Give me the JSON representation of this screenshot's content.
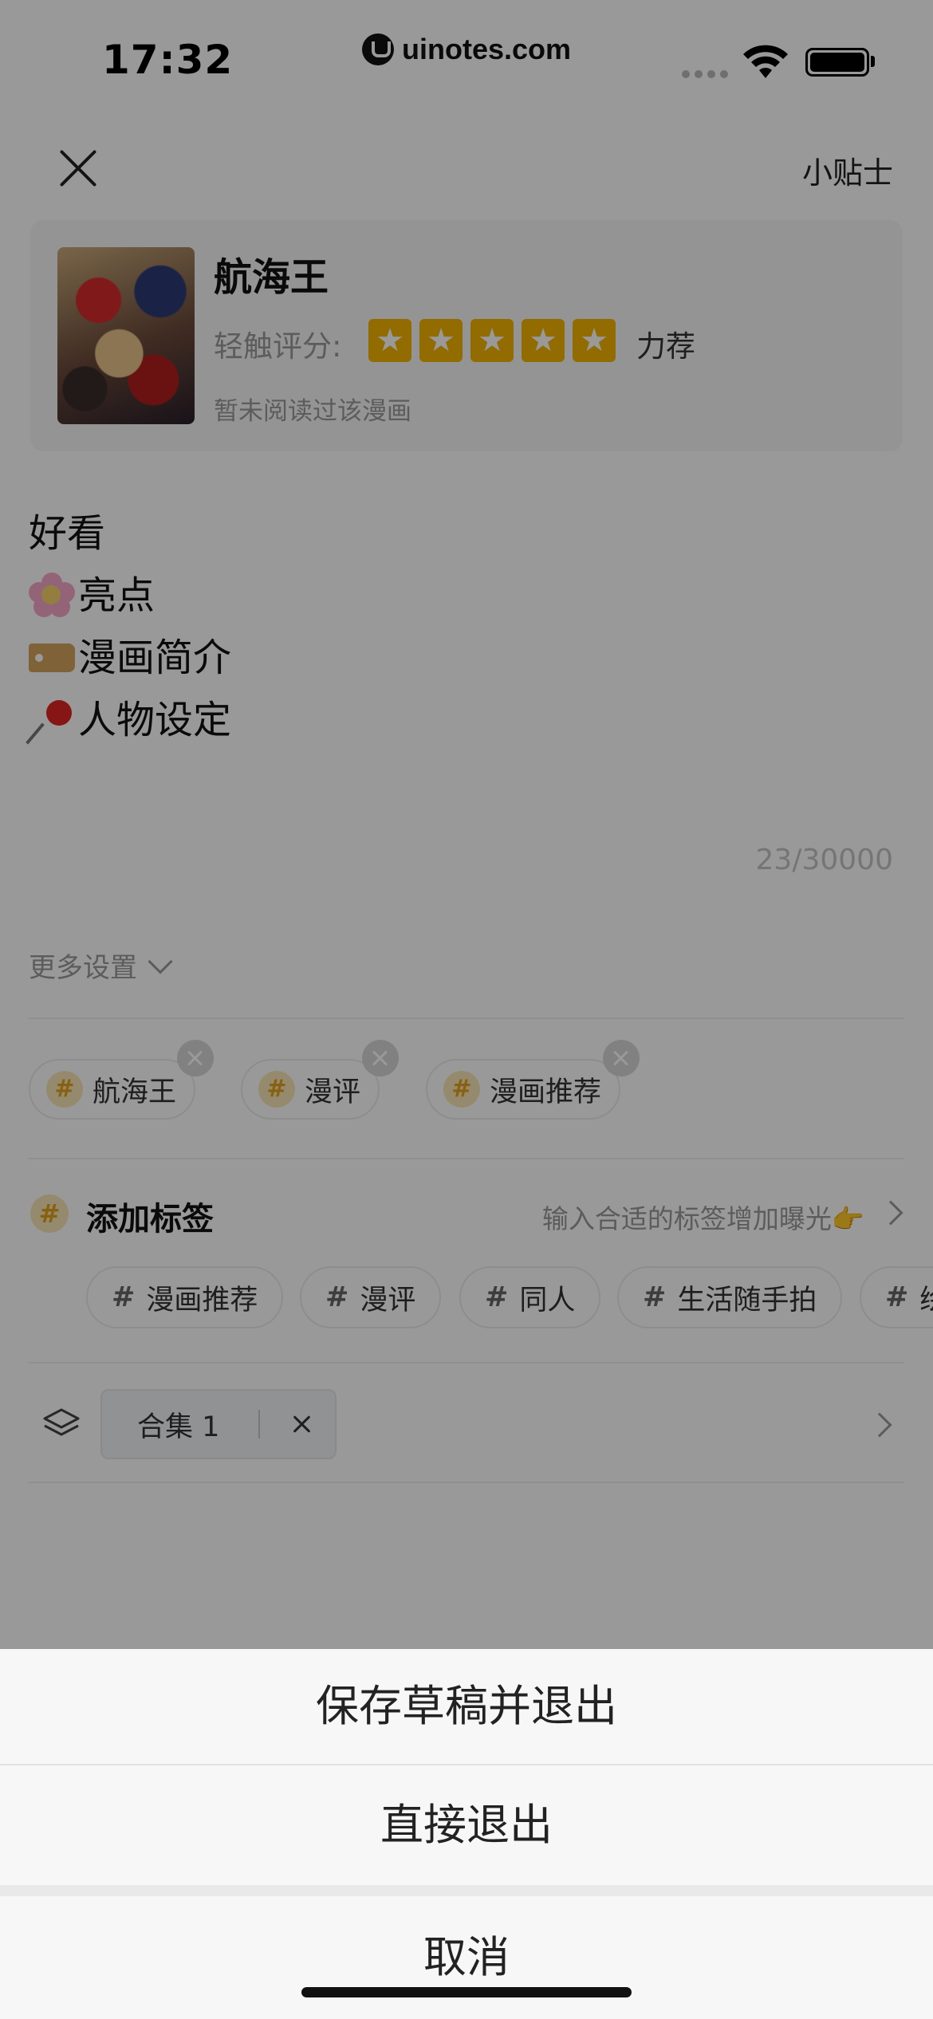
{
  "status_bar": {
    "time": "17:32",
    "watermark_url": "uinotes.com"
  },
  "top_bar": {
    "close_icon": "close-icon",
    "tips_label": "小贴士"
  },
  "comic": {
    "title": "航海王",
    "rating_label": "轻触评分:",
    "rating": 5,
    "rating_max": 5,
    "rating_text": "力荐",
    "read_status": "暂未阅读过该漫画"
  },
  "content": {
    "lines": [
      {
        "emoji": "",
        "text": "好看"
      },
      {
        "emoji": "cherry-blossom",
        "text": "亮点"
      },
      {
        "emoji": "label-tag",
        "text": "漫画简介"
      },
      {
        "emoji": "pushpin",
        "text": "人物设定"
      }
    ],
    "char_count": "23/30000"
  },
  "more_settings": {
    "label": "更多设置"
  },
  "selected_tags": [
    {
      "label": "航海王"
    },
    {
      "label": "漫评"
    },
    {
      "label": "漫画推荐"
    }
  ],
  "add_tag": {
    "title": "添加标签",
    "hint": "输入合适的标签增加曝光👉"
  },
  "suggested_tags": [
    {
      "label": "漫画推荐"
    },
    {
      "label": "漫评"
    },
    {
      "label": "同人"
    },
    {
      "label": "生活随手拍"
    },
    {
      "label": "绘"
    }
  ],
  "collection": {
    "label": "合集 1"
  },
  "action_sheet": {
    "save_draft_exit": "保存草稿并退出",
    "exit_directly": "直接退出",
    "cancel": "取消"
  },
  "colors": {
    "overlay": "#000000",
    "star": "#f4b400",
    "hash_badge_bg": "#fbe7b7",
    "hash_badge_fg": "#e2a21a"
  }
}
